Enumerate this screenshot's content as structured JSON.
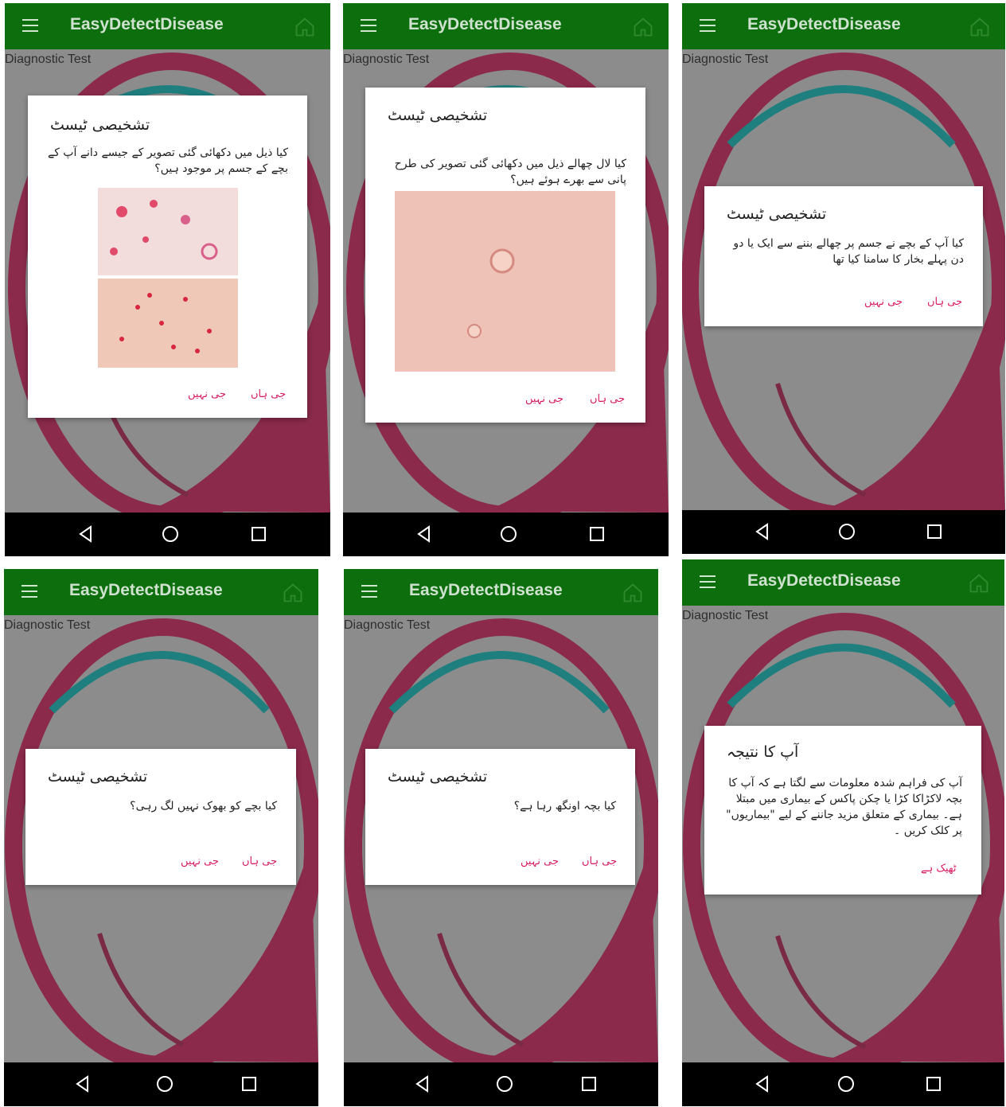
{
  "app": {
    "title": "EasyDetectDisease",
    "subtitle": "Diagnostic Test"
  },
  "colors": {
    "appbar": "#0d6e0d",
    "accent": "#d81b60",
    "logo_pink": "#8b2a4a",
    "logo_teal": "#1f7f7f"
  },
  "icons": {
    "menu": "hamburger-menu-icon",
    "home": "home-icon",
    "back": "back-triangle-icon",
    "home_nav": "home-circle-icon",
    "recent": "recent-square-icon"
  },
  "screens": [
    {
      "dialog_title": "تشخیصی ٹیسٹ",
      "question": "کیا ذیل میں دکھائی گئی تصویر کے جیسے دانے آپ کے بچے کے جسم پر موجود ہیں؟",
      "image": "chicken-pox-rash-photos",
      "yes": "جی ہاں",
      "no": "جی نہیں"
    },
    {
      "dialog_title": "تشخیصی ٹیسٹ",
      "question": "کیا لال چھالے ذیل میں دکھائی گئی تصویر کی طرح پانی سے بھرے ہوئے ہیں؟",
      "image": "fluid-filled-blister-photo",
      "yes": "جی ہاں",
      "no": "جی نہیں"
    },
    {
      "dialog_title": "تشخیصی ٹیسٹ",
      "question": "کیا آپ کے بچے نے جسم پر چھالے بننے سے ایک یا دو دن پہلے بخار کا سامنا کیا تھا",
      "yes": "جی ہاں",
      "no": "جی نہیں"
    },
    {
      "dialog_title": "تشخیصی ٹیسٹ",
      "question": "کیا بچے کو بھوک نہیں لگ رہی؟",
      "yes": "جی ہاں",
      "no": "جی نہیں"
    },
    {
      "dialog_title": "تشخیصی ٹیسٹ",
      "question": "کیا بچہ اونگھ رہا ہے؟",
      "yes": "جی ہاں",
      "no": "جی نہیں"
    },
    {
      "dialog_title": "آپ کا نتیجہ",
      "question": "آپ کی فراہم شدہ معلومات سے لگتا ہے کہ آپ کا بچہ لاکڑاکا کڑا یا چکن پاکس کے بیماری میں مبتلا ہے۔ بیماری کے متعلق مزید جاننے کے لیے \"بیماریوں\" پر کلک کریں ۔",
      "ok": "ٹھیک ہے"
    }
  ]
}
